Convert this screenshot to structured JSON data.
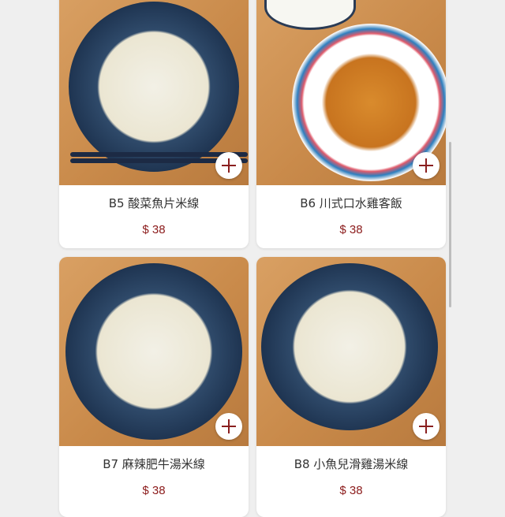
{
  "colors": {
    "background": "#efefef",
    "card": "#ffffff",
    "price": "#8b1a1a",
    "add_icon": "#8a1f1f"
  },
  "menu_items": [
    {
      "name": "B5 酸菜魚片米線",
      "price": "$ 38",
      "photo": "bowl-noodles-pickled-fish",
      "action_icon": "plus-icon"
    },
    {
      "name": "B6 川式口水雞客飯",
      "price": "$ 38",
      "photo": "plate-chili-chicken-rice",
      "action_icon": "plus-icon"
    },
    {
      "name": "B7 麻辣肥牛湯米線",
      "price": "$ 38",
      "photo": "bowl-spicy-beef-noodles",
      "action_icon": "plus-icon"
    },
    {
      "name": "B8 小魚兒滑雞湯米線",
      "price": "$ 38",
      "photo": "bowl-chicken-soup-noodles",
      "action_icon": "plus-icon"
    }
  ]
}
